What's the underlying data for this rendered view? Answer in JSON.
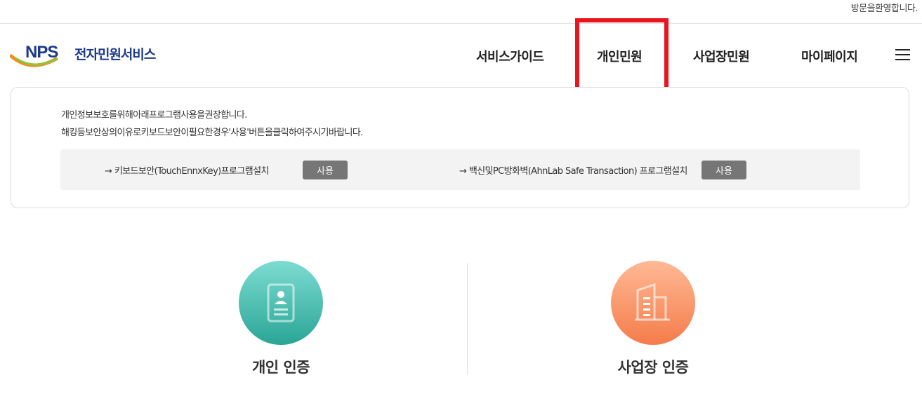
{
  "topbar": {
    "welcome_text": "방문을환영합니다."
  },
  "header": {
    "logo_text": "전자민원서비스",
    "nav": {
      "guide": "서비스가이드",
      "personal": "개인민원",
      "business": "사업장민원",
      "mypage": "마이페이지"
    },
    "menu_icon": "hamburger-icon"
  },
  "notice": {
    "line1": "개인정보보호를위해아래프로그램사용을권장합니다.",
    "line2": "해킹등보안상의이유로키보드보안이필요한경우'사용'버튼을클릭하여주시기바랍니다.",
    "programs": [
      {
        "label": "→ 키보드보안(TouchEnnxKey)프로그램설치",
        "button": "사용"
      },
      {
        "label": "→ 백신및PC방화벽(AhnLab Safe Transaction) 프로그램설치",
        "button": "사용"
      }
    ]
  },
  "auth": {
    "personal": {
      "label": "개인 인증",
      "icon": "id-card-icon"
    },
    "business": {
      "label": "사업장 인증",
      "icon": "building-icon"
    }
  },
  "colors": {
    "highlight": "#e8141e",
    "brand_blue": "#1b3a8c",
    "personal_teal": "#2aa596",
    "business_orange": "#f47c4a",
    "button_gray": "#767676"
  }
}
